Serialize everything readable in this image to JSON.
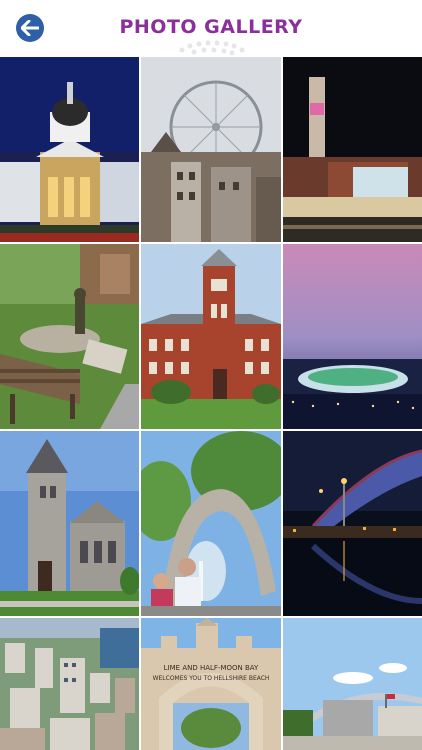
{
  "header": {
    "title": "PHOTO GALLERY",
    "back_icon": "back-arrow-icon",
    "accent_color": "#8a2f9c",
    "back_color": "#2e5fa8"
  },
  "gallery": {
    "photos": [
      {
        "subject": "City hall dome at night"
      },
      {
        "subject": "Ferris wheel over town"
      },
      {
        "subject": "Clock tower at night"
      },
      {
        "subject": "Park with bench and statue"
      },
      {
        "subject": "Red brick town hall"
      },
      {
        "subject": "Stadium at dusk"
      },
      {
        "subject": "Stone church with steeple"
      },
      {
        "subject": "Fountain arch sculpture"
      },
      {
        "subject": "Bridge at night over river"
      },
      {
        "subject": "Aerial city view"
      },
      {
        "subject": "Beach welcome arch"
      },
      {
        "subject": "Harbour arch and buildings"
      }
    ],
    "arch_text": "LIME AND HALF-MOON BAY WELCOMES YOU TO HELLSHIRE BEACH"
  }
}
